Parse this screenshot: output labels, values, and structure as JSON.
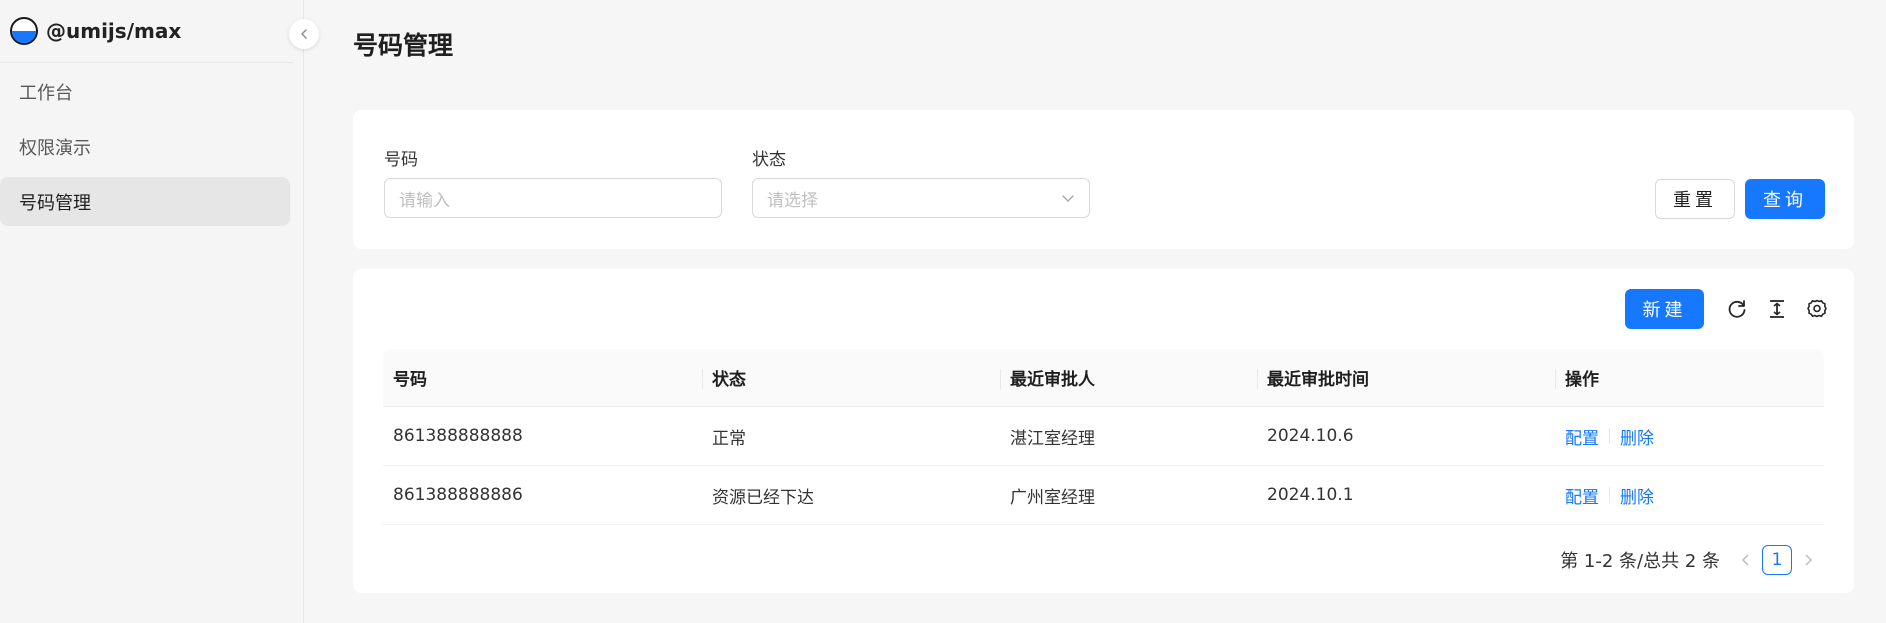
{
  "brand": {
    "title": "@umijs/max"
  },
  "sidebar": {
    "items": [
      {
        "label": "工作台",
        "active": false
      },
      {
        "label": "权限演示",
        "active": false
      },
      {
        "label": "号码管理",
        "active": true
      }
    ]
  },
  "page": {
    "title": "号码管理"
  },
  "search": {
    "number_label": "号码",
    "number_placeholder": "请输入",
    "status_label": "状态",
    "status_placeholder": "请选择",
    "reset_label": "重置",
    "query_label": "查询"
  },
  "toolbar": {
    "new_label": "新建",
    "icons": [
      "reload-icon",
      "density-icon",
      "settings-icon"
    ]
  },
  "table": {
    "columns": [
      "号码",
      "状态",
      "最近审批人",
      "最近审批时间",
      "操作"
    ],
    "rows": [
      {
        "number": "861388888888",
        "status": "正常",
        "approver": "湛江室经理",
        "time": "2024.10.6",
        "action_config": "配置",
        "action_delete": "删除"
      },
      {
        "number": "861388888886",
        "status": "资源已经下达",
        "approver": "广州室经理",
        "time": "2024.10.1",
        "action_config": "配置",
        "action_delete": "删除"
      }
    ]
  },
  "pagination": {
    "summary": "第 1-2 条/总共 2 条",
    "current_page": "1"
  },
  "colors": {
    "primary": "#1677ff"
  }
}
